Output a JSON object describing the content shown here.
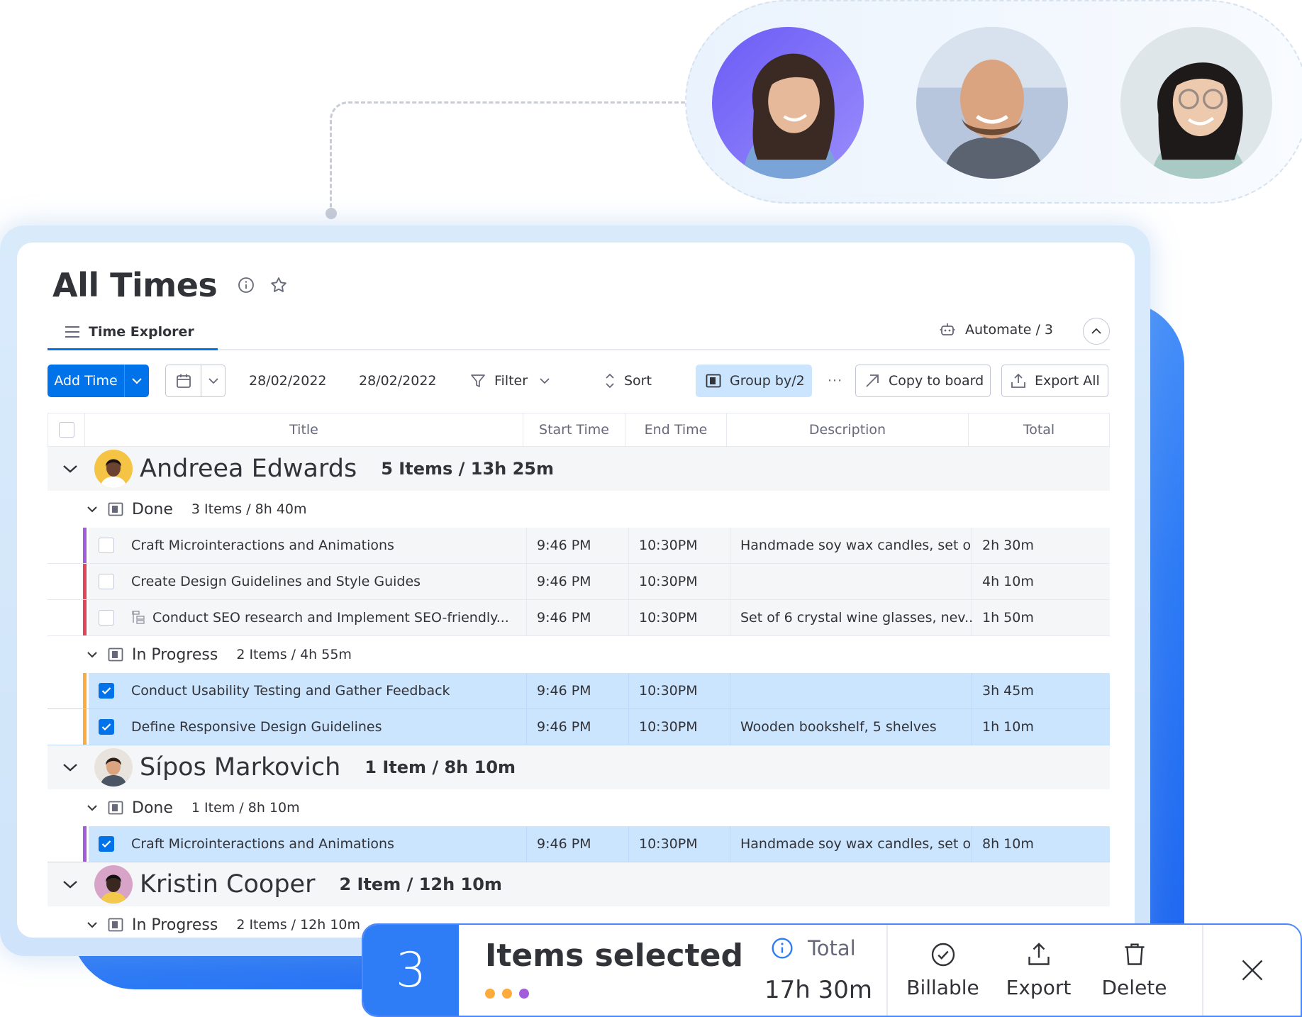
{
  "page": {
    "title": "All Times",
    "info_icon": "info-circle-icon",
    "star_icon": "star-icon"
  },
  "tabs": {
    "active_label": "Time Explorer",
    "automate_label": "Automate / 3"
  },
  "toolbar": {
    "add_time_label": "Add Time",
    "start_date": "28/02/2022",
    "end_date": "28/02/2022",
    "filter_label": "Filter",
    "sort_label": "Sort",
    "group_by_label": "Group by/2",
    "more_label": "···",
    "copy_to_board_label": "Copy to board",
    "export_all_label": "Export All"
  },
  "columns": {
    "title": "Title",
    "start_time": "Start Time",
    "end_time": "End Time",
    "description": "Description",
    "total": "Total"
  },
  "people": [
    {
      "name": "Andreea Edwards",
      "count": "5 Items / 13h 25m",
      "avatar_bg": "#f6c445",
      "groups": [
        {
          "name": "Done",
          "count": "3 Items / 8h 40m",
          "rows": [
            {
              "title": "Craft Microinteractions and Animations",
              "start": "9:46 PM",
              "end": "10:30PM",
              "description": "Handmade soy wax candles, set o...",
              "total": "2h 30m",
              "color": "#a25ddc",
              "selected": false,
              "subitem": false
            },
            {
              "title": "Create Design Guidelines and Style Guides",
              "start": "9:46 PM",
              "end": "10:30PM",
              "description": "",
              "total": "4h 10m",
              "color": "#e2445c",
              "selected": false,
              "subitem": false
            },
            {
              "title": "Conduct SEO research and Implement SEO-friendly...",
              "start": "9:46 PM",
              "end": "10:30PM",
              "description": "Set of 6 crystal wine glasses, nev...",
              "total": "1h 50m",
              "color": "#e2445c",
              "selected": false,
              "subitem": true
            }
          ]
        },
        {
          "name": "In Progress",
          "count": "2 Items / 4h 55m",
          "rows": [
            {
              "title": "Conduct Usability Testing and Gather Feedback",
              "start": "9:46 PM",
              "end": "10:30PM",
              "description": "",
              "total": "3h 45m",
              "color": "#fdab3d",
              "selected": true,
              "subitem": false
            },
            {
              "title": "Define Responsive Design Guidelines",
              "start": "9:46 PM",
              "end": "10:30PM",
              "description": "Wooden bookshelf, 5 shelves",
              "total": "1h 10m",
              "color": "#fdab3d",
              "selected": true,
              "subitem": false
            }
          ]
        }
      ]
    },
    {
      "name": "Sípos Markovich",
      "count": "1 Item / 8h 10m",
      "avatar_bg": "#e8e3dc",
      "groups": [
        {
          "name": "Done",
          "count": "1 Item / 8h 10m",
          "rows": [
            {
              "title": "Craft Microinteractions and Animations",
              "start": "9:46 PM",
              "end": "10:30PM",
              "description": "Handmade soy wax candles, set o...",
              "total": "8h 10m",
              "color": "#a25ddc",
              "selected": true,
              "subitem": false
            }
          ]
        }
      ]
    },
    {
      "name": "Kristin Cooper",
      "count": "2 Item / 12h 10m",
      "avatar_bg": "#d7a3c6",
      "groups": [
        {
          "name": "In Progress",
          "count": "2 Items / 12h 10m",
          "rows": []
        }
      ]
    }
  ],
  "selection_bar": {
    "count": "3",
    "label": "Items selected",
    "total_label": "Total",
    "total_value": "17h 30m",
    "dot_colors": [
      "#fdab3d",
      "#fdab3d",
      "#a25ddc"
    ],
    "actions": [
      {
        "label": "Billable",
        "icon": "check-circle-icon"
      },
      {
        "label": "Export",
        "icon": "upload-icon"
      },
      {
        "label": "Delete",
        "icon": "trash-icon"
      }
    ],
    "close_icon": "close-icon"
  },
  "colors": {
    "primary": "#0073ea",
    "selected_row": "#cce5ff",
    "group_by_bg": "#cce5ff",
    "selection_count_bg": "#2e7df6"
  }
}
